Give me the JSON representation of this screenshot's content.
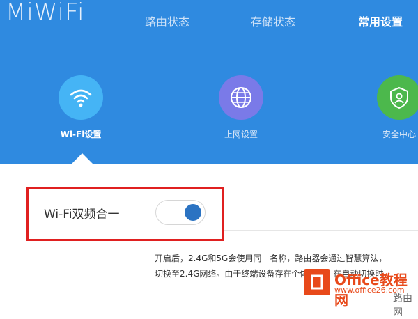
{
  "app": {
    "logo": "MiWiFi"
  },
  "nav": [
    {
      "label": "路由状态",
      "active": false
    },
    {
      "label": "存储状态",
      "active": false
    },
    {
      "label": "常用设置",
      "active": true
    }
  ],
  "features": [
    {
      "label": "Wi-Fi设置",
      "icon": "wifi-icon",
      "color": "#45b4f5",
      "active": true
    },
    {
      "label": "上网设置",
      "icon": "globe-icon",
      "color": "#7a7ae8",
      "active": false
    },
    {
      "label": "安全中心",
      "icon": "shield-icon",
      "color": "#4cb84c",
      "active": false
    }
  ],
  "wifi_dual_band": {
    "label": "Wi-Fi双频合一",
    "enabled": true
  },
  "description": {
    "line1": "开启后，2.4G和5G会使用同一名称，路由器会通过智慧算法，",
    "line2": "切换至2.4G网络。由于终端设备存在个体差异，在自动切换时"
  },
  "watermark": {
    "brand": "Office教程网",
    "url": "www.office26.com",
    "side_text": "路由网"
  },
  "colors": {
    "header_bg": "#2f8ae0",
    "highlight_border": "#e02020",
    "toggle_knob": "#2b73c2"
  }
}
